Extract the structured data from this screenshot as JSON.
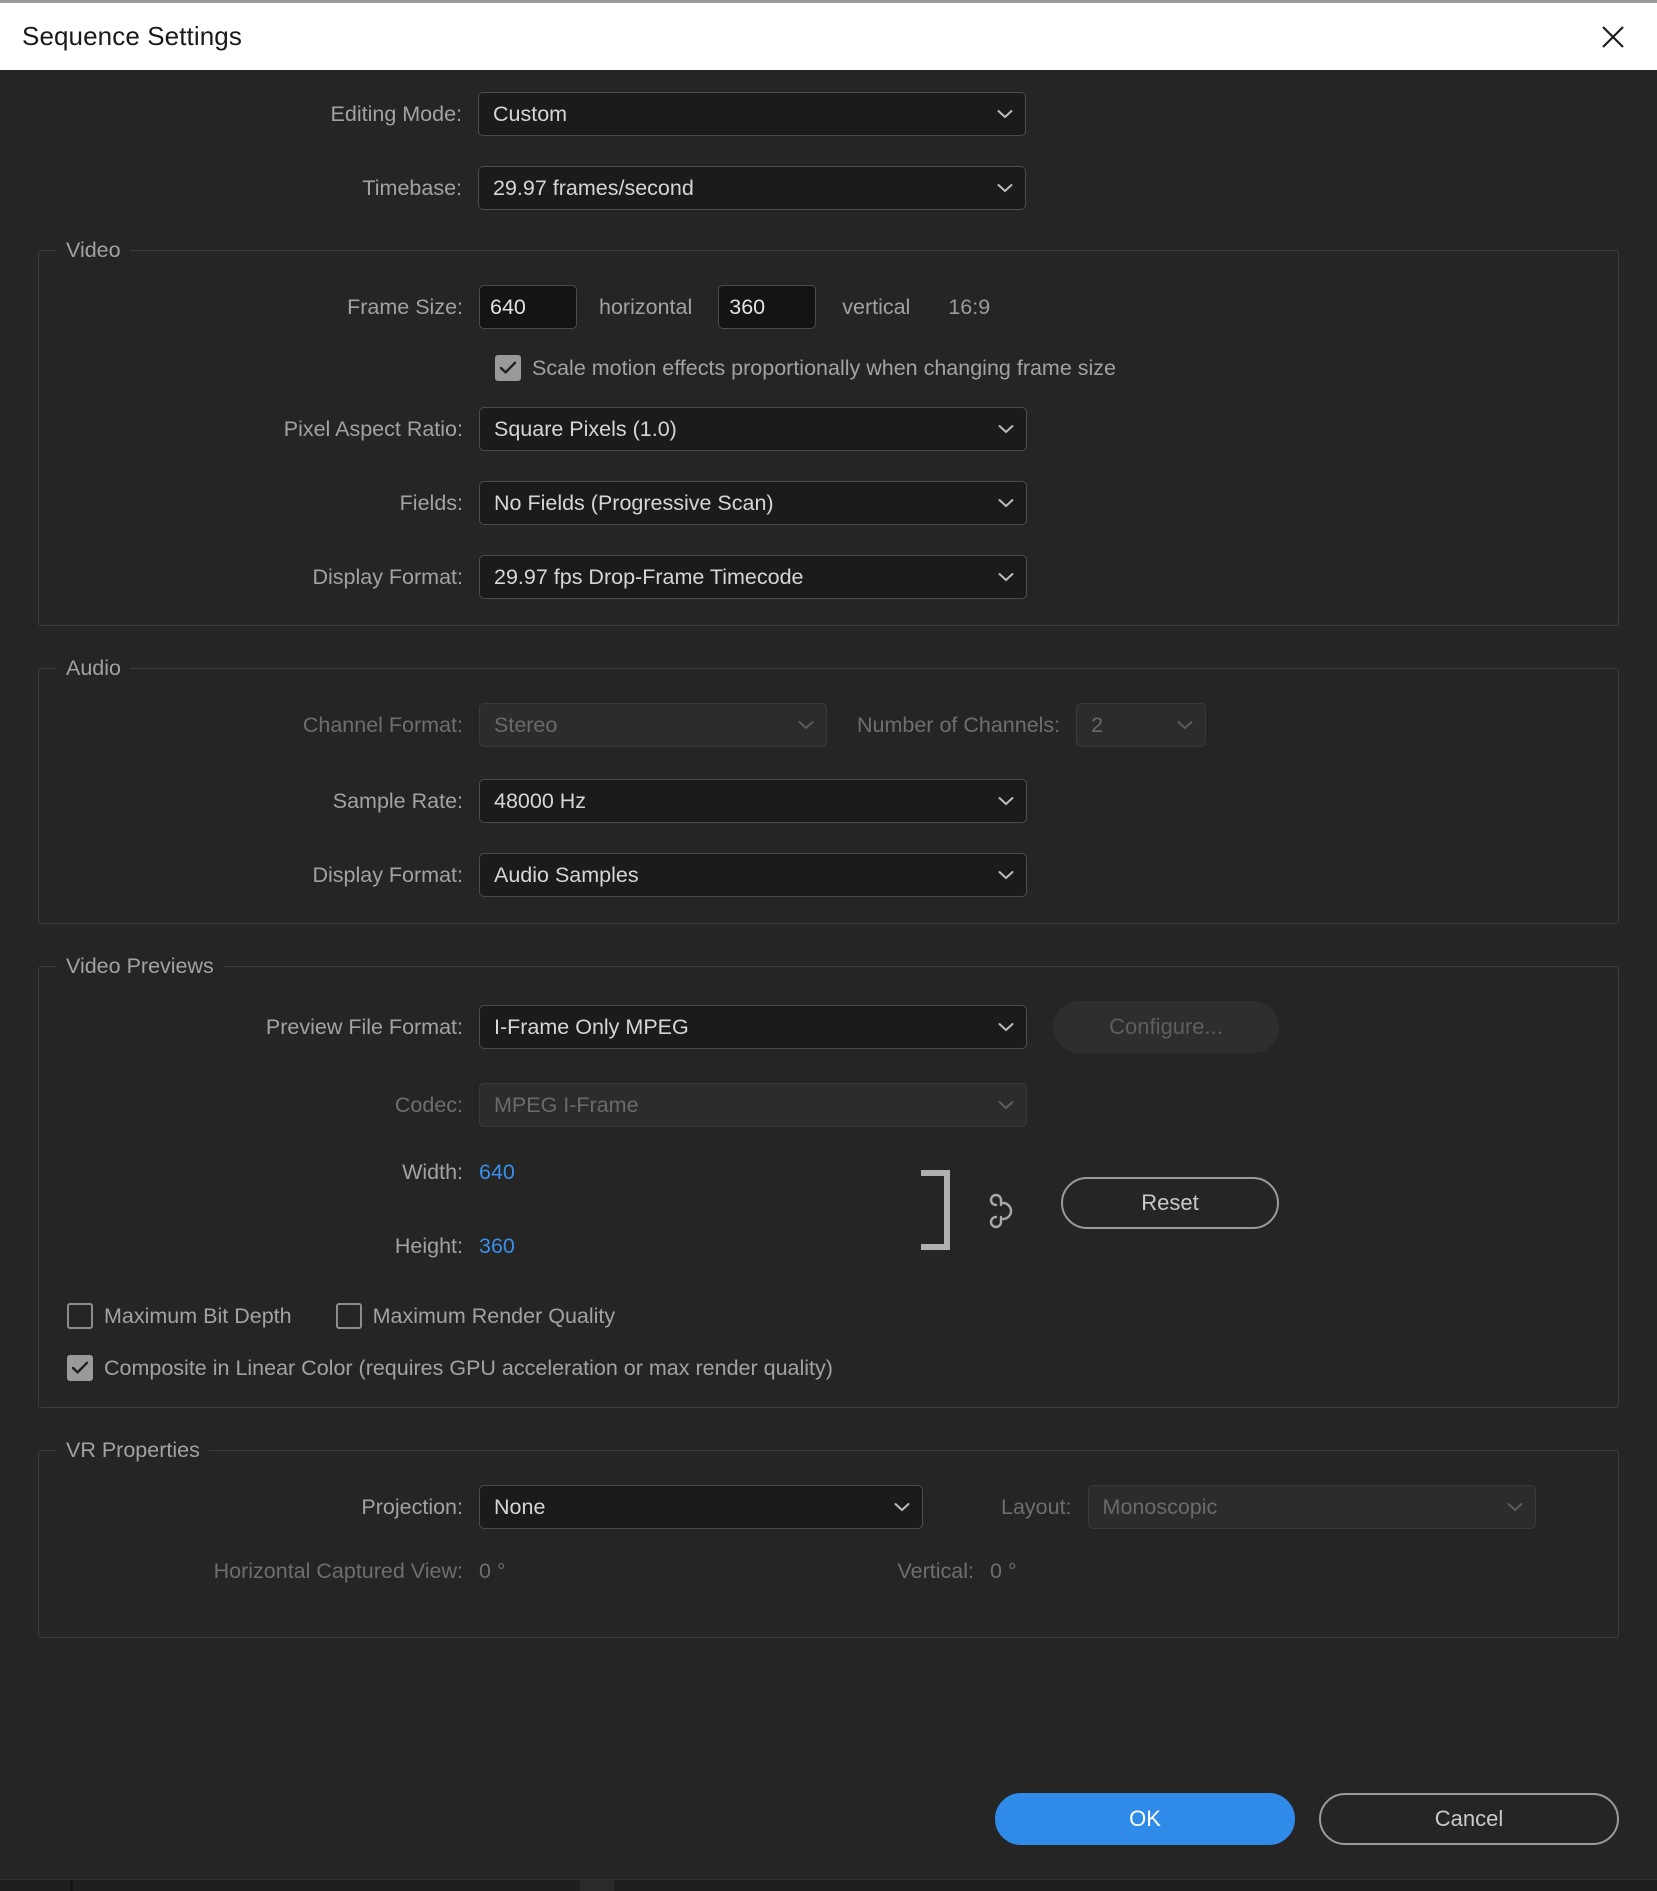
{
  "window": {
    "title": "Sequence Settings",
    "close_icon": "close-icon"
  },
  "top_fields": [
    {
      "label": "Editing Mode:",
      "value": "Custom"
    },
    {
      "label": "Timebase:",
      "value": "29.97  frames/second"
    }
  ],
  "video": {
    "group_title": "Video",
    "frame_size": {
      "label": "Frame Size:",
      "width_value": "640",
      "horizontal_label": "horizontal",
      "height_value": "360",
      "vertical_label": "vertical",
      "aspect_ratio": "16:9"
    },
    "scale_motion": {
      "label": "Scale motion effects proportionally when changing frame size",
      "checked": true
    },
    "pixel_aspect_ratio": {
      "label": "Pixel Aspect Ratio:",
      "value": "Square Pixels (1.0)"
    },
    "fields": {
      "label": "Fields:",
      "value": "No Fields (Progressive Scan)"
    },
    "display_format": {
      "label": "Display Format:",
      "value": "29.97 fps Drop-Frame Timecode"
    }
  },
  "audio": {
    "group_title": "Audio",
    "channel_format": {
      "label": "Channel Format:",
      "value": "Stereo",
      "disabled": true
    },
    "number_of_channels": {
      "label": "Number of Channels:",
      "value": "2",
      "disabled": true
    },
    "sample_rate": {
      "label": "Sample Rate:",
      "value": "48000 Hz"
    },
    "display_format": {
      "label": "Display Format:",
      "value": "Audio Samples"
    }
  },
  "video_previews": {
    "group_title": "Video Previews",
    "preview_file_format": {
      "label": "Preview File Format:",
      "value": "I-Frame Only MPEG"
    },
    "configure_button": {
      "label": "Configure...",
      "disabled": true
    },
    "codec": {
      "label": "Codec:",
      "value": "MPEG I-Frame",
      "disabled": true
    },
    "width": {
      "label": "Width:",
      "value": "640"
    },
    "height": {
      "label": "Height:",
      "value": "360"
    },
    "link_icon": "link-icon",
    "bracket_icon": "bracket-icon",
    "reset_button": {
      "label": "Reset"
    },
    "maximum_bit_depth": {
      "label": "Maximum Bit Depth",
      "checked": false
    },
    "maximum_render_quality": {
      "label": "Maximum Render Quality",
      "checked": false
    },
    "composite_linear_color": {
      "label": "Composite in Linear Color (requires GPU acceleration or max render quality)",
      "checked": true
    }
  },
  "vr_properties": {
    "group_title": "VR Properties",
    "projection": {
      "label": "Projection:",
      "value": "None"
    },
    "layout": {
      "label": "Layout:",
      "value": "Monoscopic",
      "disabled": true
    },
    "horizontal_captured_view": {
      "label": "Horizontal Captured View:",
      "value": "0 °"
    },
    "vertical": {
      "label": "Vertical:",
      "value": "0 °"
    }
  },
  "footer": {
    "ok_label": "OK",
    "cancel_label": "Cancel"
  },
  "colors": {
    "accent_blue": "#2f8ae8",
    "value_blue": "#3a8fe8",
    "dialog_bg": "#252525",
    "titlebar_bg": "#ffffff",
    "label_text": "#a2a2a2"
  }
}
